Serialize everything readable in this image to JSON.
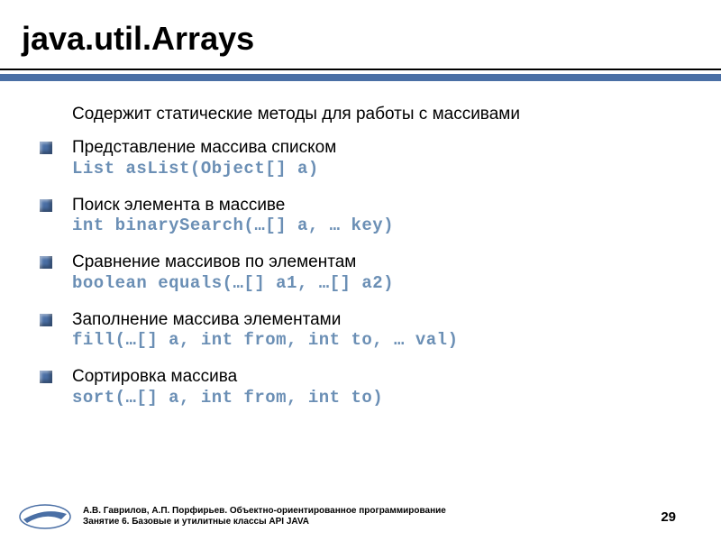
{
  "title": "java.util.Arrays",
  "intro": "Содержит статические методы для работы с массивами",
  "items": [
    {
      "text": "Представление массива списком",
      "code": "List asList(Object[] a)"
    },
    {
      "text": "Поиск элемента в массиве",
      "code": "int binarySearch(…[] a, … key)"
    },
    {
      "text": "Сравнение массивов по элементам",
      "code": "boolean equals(…[] a1, …[] a2)"
    },
    {
      "text": "Заполнение массива элементами",
      "code": "fill(…[] a, int from, int to, … val)"
    },
    {
      "text": "Сортировка массива",
      "code": "sort(…[] a, int from, int to)"
    }
  ],
  "footer": {
    "line1": "А.В. Гаврилов, А.П. Порфирьев. Объектно-ориентированное программирование",
    "line2": "Занятие 6. Базовые и утилитные классы API JAVA",
    "page": "29"
  }
}
